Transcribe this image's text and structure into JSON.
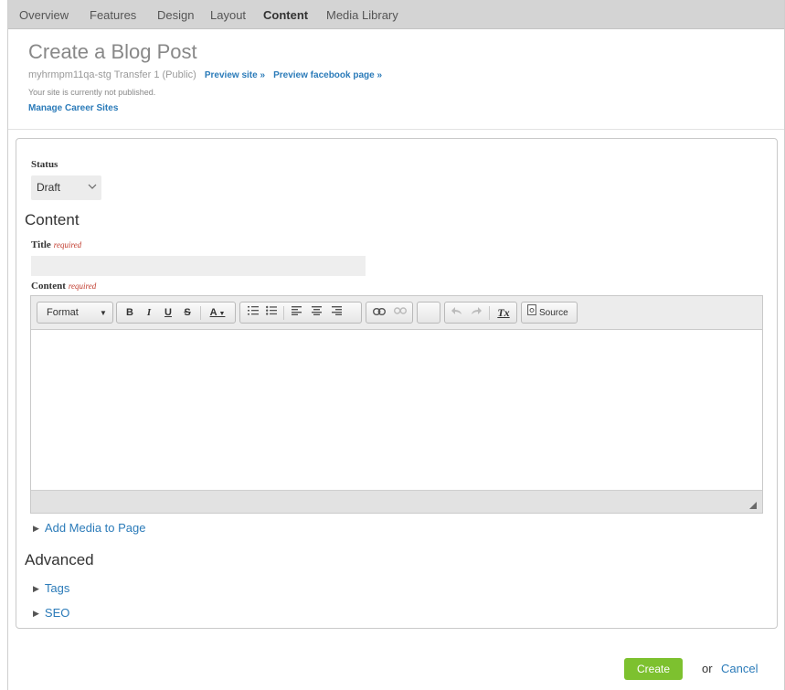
{
  "nav": {
    "items": [
      {
        "label": "Overview"
      },
      {
        "label": "Features"
      },
      {
        "label": "Design"
      },
      {
        "label": "Layout"
      },
      {
        "label": "Content",
        "active": true
      },
      {
        "label": "Media Library"
      }
    ]
  },
  "header": {
    "title": "Create a Blog Post",
    "site_name": "myhrmpm11qa-stg Transfer 1 (Public)",
    "preview_site": "Preview site »",
    "preview_facebook": "Preview facebook page »",
    "not_published": "Your site is currently not published.",
    "manage_career_sites": "Manage Career Sites"
  },
  "form": {
    "status_label": "Status",
    "status_value": "Draft",
    "content_heading": "Content",
    "title_label": "Title",
    "required": "required",
    "title_value": "",
    "content_label": "Content",
    "toolbar": {
      "format": "Format",
      "bold": "B",
      "italic": "I",
      "underline": "U",
      "strike": "S",
      "text_color": "A",
      "source": "Source",
      "remove_format": "Tx"
    },
    "add_media": "Add Media to Page",
    "advanced_heading": "Advanced",
    "tags": "Tags",
    "seo": "SEO"
  },
  "actions": {
    "create": "Create",
    "or": "or",
    "cancel": "Cancel"
  },
  "colors": {
    "accent_link": "#2b7bb9",
    "create_button": "#7dc12f",
    "required": "#c0392b"
  }
}
